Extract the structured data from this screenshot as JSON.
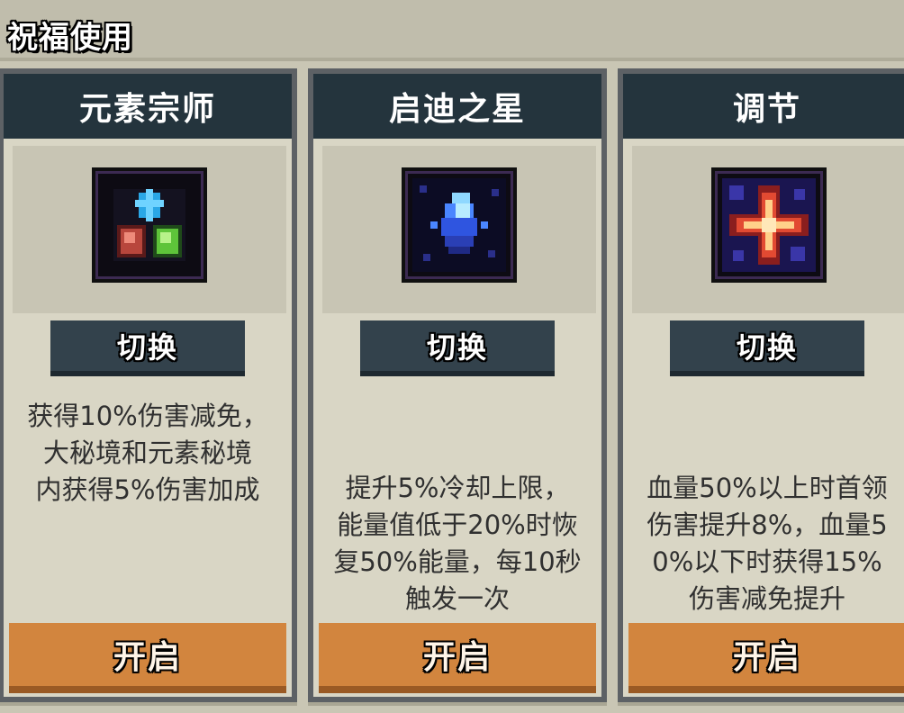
{
  "header": {
    "title": "祝福使用"
  },
  "cards": [
    {
      "title": "元素宗师",
      "icon": "element-master-icon",
      "switch_label": "切换",
      "description": "获得10%伤害减免，\n大秘境和元素秘境\n内获得5%伤害加成",
      "open_label": "开启"
    },
    {
      "title": "启迪之星",
      "icon": "enlightenment-star-icon",
      "switch_label": "切换",
      "description": "提升5%冷却上限，\n能量值低于20%时恢\n复50%能量，每10秒\n触发一次",
      "open_label": "开启"
    },
    {
      "title": "调节",
      "icon": "adjust-cross-icon",
      "switch_label": "切换",
      "description": "血量50%以上时首领\n伤害提升8%，血量5\n0%以下时获得15%\n伤害减免提升",
      "open_label": "开启"
    }
  ]
}
